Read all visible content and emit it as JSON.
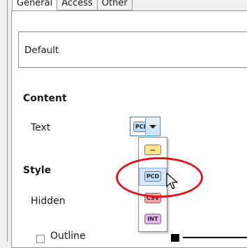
{
  "tabs": [
    {
      "label": "General",
      "active": true
    },
    {
      "label": "Access",
      "active": false
    },
    {
      "label": "Other",
      "active": false
    }
  ],
  "name_field": {
    "value": "Default"
  },
  "content": {
    "header": "Content",
    "text_label": "Text",
    "selected_badge": "PCD"
  },
  "style": {
    "header": "Style",
    "hidden_label": "Hidden",
    "outline_label": "Outline"
  },
  "dropdown_options": [
    {
      "label": "—",
      "color": "#fde78a",
      "hovered": false
    },
    {
      "label": "PCD",
      "color": "#bfe0f7",
      "hovered": true
    },
    {
      "label": "CSV",
      "color": "#f5a3a3",
      "hovered": false
    },
    {
      "label": "INT",
      "color": "#e8b5f0",
      "hovered": false
    }
  ],
  "colors": {
    "highlight": "#e0161e",
    "selected_badge_bg": "#bfe0f7"
  }
}
